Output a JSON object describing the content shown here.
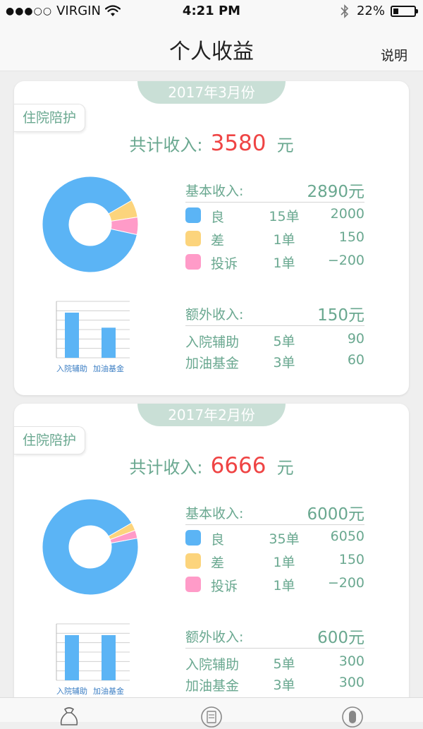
{
  "status_bar": {
    "signal": "●●●○○",
    "carrier": "VIRGIN",
    "time": "4:21 PM",
    "battery_percent": "22%",
    "battery_level": 0.22
  },
  "nav": {
    "title": "个人收益",
    "right_label": "说明"
  },
  "legend": {
    "good_color": "#5bb4f5",
    "bad_color": "#fcd47c",
    "complaint_color": "#ff9bc8"
  },
  "cards": [
    {
      "month": "2017年3月份",
      "service": "住院陪护",
      "total_label": "共计收入:",
      "total_value": "3580",
      "total_unit": "元",
      "basic_label": "基本收入:",
      "basic_total": "2890元",
      "basic_rows": [
        {
          "label": "良",
          "count": "15单",
          "amount": "2000"
        },
        {
          "label": "差",
          "count": "1单",
          "amount": "150"
        },
        {
          "label": "投诉",
          "count": "1单",
          "amount": "−200"
        }
      ],
      "extra_label": "额外收入:",
      "extra_total": "150元",
      "extra_rows": [
        {
          "label": "入院辅助",
          "count": "5单",
          "amount": "90"
        },
        {
          "label": "加油基金",
          "count": "3单",
          "amount": "60"
        }
      ],
      "chart_data": {
        "type": "pie",
        "categories": [
          "良",
          "差",
          "投诉"
        ],
        "values": [
          15,
          1,
          1
        ]
      },
      "bar_chart_data": {
        "type": "bar",
        "categories": [
          "入院辅助",
          "加油基金"
        ],
        "values": [
          90,
          60
        ]
      }
    },
    {
      "month": "2017年2月份",
      "service": "住院陪护",
      "total_label": "共计收入:",
      "total_value": "6666",
      "total_unit": "元",
      "basic_label": "基本收入:",
      "basic_total": "6000元",
      "basic_rows": [
        {
          "label": "良",
          "count": "35单",
          "amount": "6050"
        },
        {
          "label": "差",
          "count": "1单",
          "amount": "150"
        },
        {
          "label": "投诉",
          "count": "1单",
          "amount": "−200"
        }
      ],
      "extra_label": "额外收入:",
      "extra_total": "600元",
      "extra_rows": [
        {
          "label": "入院辅助",
          "count": "5单",
          "amount": "300"
        },
        {
          "label": "加油基金",
          "count": "3单",
          "amount": "300"
        }
      ],
      "chart_data": {
        "type": "pie",
        "categories": [
          "良",
          "差",
          "投诉"
        ],
        "values": [
          35,
          1,
          1
        ]
      },
      "bar_chart_data": {
        "type": "bar",
        "categories": [
          "入院辅助",
          "加油基金"
        ],
        "values": [
          300,
          300
        ]
      }
    }
  ],
  "tabbar": {
    "items": [
      {
        "icon": "money-bag-icon"
      },
      {
        "icon": "clipboard-icon"
      },
      {
        "icon": "profile-icon"
      }
    ]
  }
}
